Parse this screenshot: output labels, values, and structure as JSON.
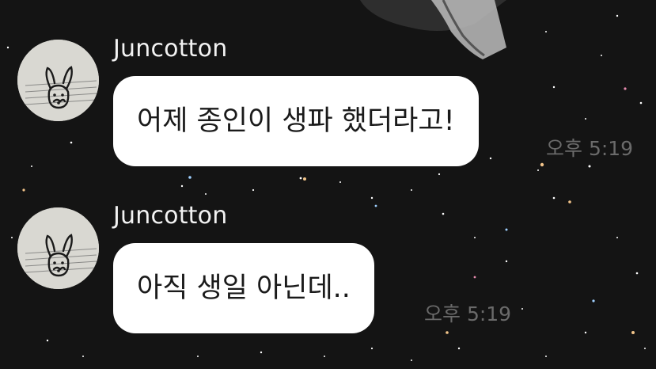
{
  "messages": [
    {
      "sender": "Juncotton",
      "text": "어제 종인이 생파 했더라고!",
      "time": "오후 5:19"
    },
    {
      "sender": "Juncotton",
      "text": "아직 생일 아닌데..",
      "time": "오후 5:19"
    }
  ],
  "icons": {
    "avatar": "bunny-sketch-avatar"
  },
  "colors": {
    "background": "#141414",
    "bubble": "#ffffff",
    "sender_text": "#f2f2f2",
    "time_text": "#6a6a6a"
  }
}
